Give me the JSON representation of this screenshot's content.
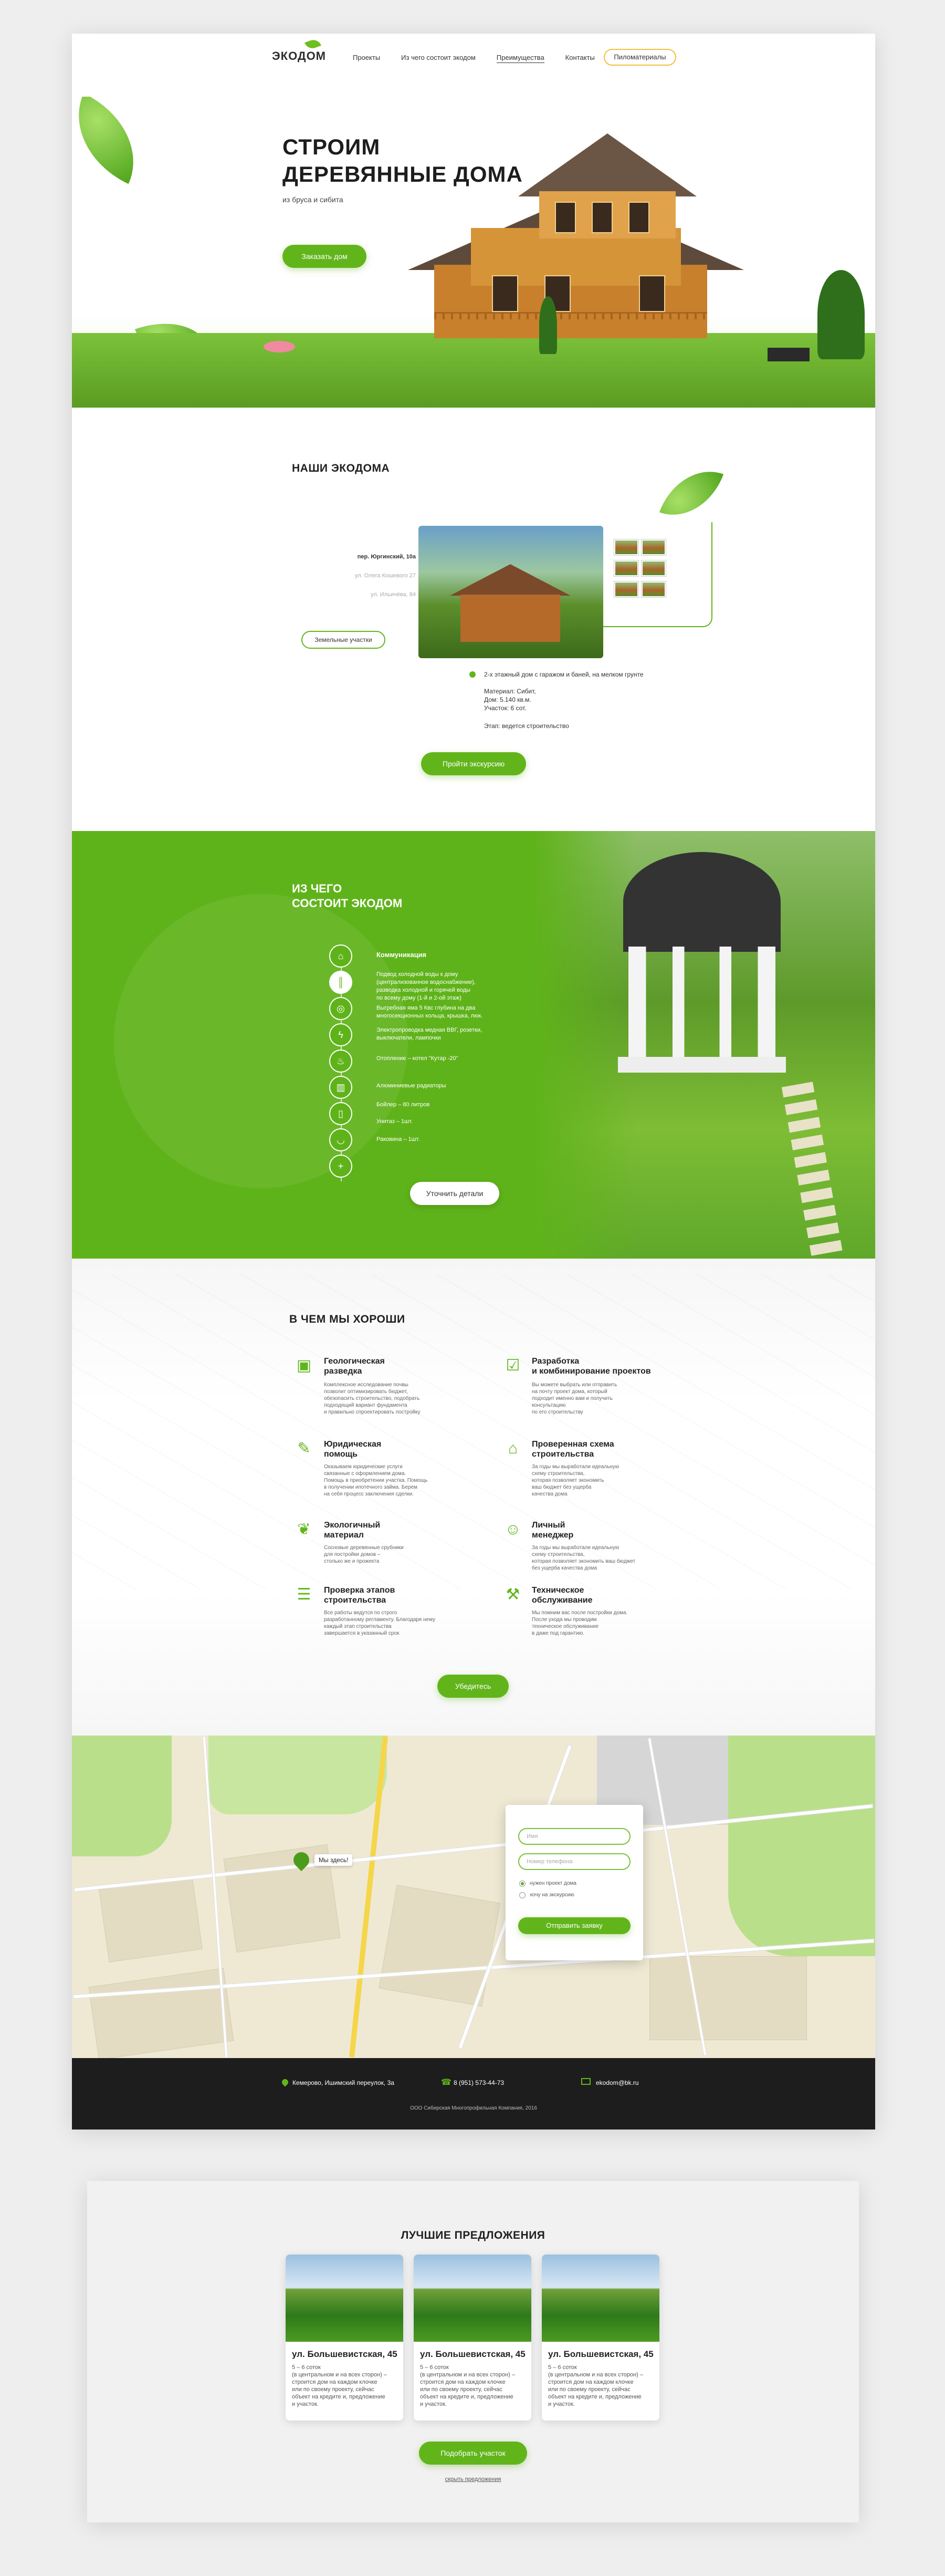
{
  "header": {
    "logo": "ЭКОДОМ",
    "nav": [
      "Проекты",
      "Из чего состоит экодом",
      "Преимущества",
      "Контакты"
    ],
    "active_nav": 2,
    "cta": "Пиломатериалы"
  },
  "hero": {
    "title": "СТРОИМ\nДЕРЕВЯННЫЕ ДОМА",
    "subtitle": "из бруса и сибита",
    "button": "Заказать дом"
  },
  "projects": {
    "title": "НАШИ ЭКОДОМА",
    "addresses": [
      "пер. Юргинский, 10а",
      "ул. Олега Кошевого 27",
      "ул. Ильичёва, 84"
    ],
    "plots_button": "Земельные участки",
    "info_lead": "2-х этажный дом с гаражом и баней, на мелком грунте",
    "info_spec": "Материал: Сибит,\nДом: 5.140 кв.м.\nУчасток: 6 сот.",
    "info_stage": "Этап: ведется строительство",
    "button": "Пройти экскурсию"
  },
  "components": {
    "title": "ИЗ ЧЕГО\nСОСТОИТ ЭКОДОМ",
    "items": [
      {
        "icon": "foundation-icon",
        "text": "Коммуникация",
        "bold": true
      },
      {
        "icon": "pipes-icon",
        "text": "Подвод холодной воды к дому\n(централизованное водоснабжение),\nразводка холодной и горячей воды\nпо всему дому (1-й и 2-ой этаж)"
      },
      {
        "icon": "well-icon",
        "text": "Выгребная яма 5 Квс глубина на два\nмногосекционных кольца, крышка, люк."
      },
      {
        "icon": "electric-icon",
        "text": "Электропроводка медная ВВГ, розетки,\nвыключатели, лампочки"
      },
      {
        "icon": "heating-icon",
        "text": "Отопление – котел \"Кутар -20\""
      },
      {
        "icon": "radiator-icon",
        "text": "Алюминиевые радиаторы"
      },
      {
        "icon": "boiler-icon",
        "text": "Бойлер – 80 литров"
      },
      {
        "icon": "sink-icon",
        "text": "Унитаз – 1шт."
      },
      {
        "icon": "shower-icon",
        "text": "Раковина – 1шт."
      },
      {
        "icon": "plus-icon",
        "text": ""
      }
    ],
    "button": "Уточнить детали"
  },
  "advantages": {
    "title": "В ЧЕМ МЫ ХОРОШИ",
    "items": [
      {
        "icon": "geology-icon",
        "title": "Геологическая\nразведка",
        "text": "Комплексное исследование почвы\nпозволит оптимизировать бюджет,\nобезопасить строительство, подобрать\nподходящий вариант фундамента\nи правильно спроектировать постройку"
      },
      {
        "icon": "blueprint-icon",
        "title": "Разработка\nи комбинирование проектов",
        "text": "Вы можете выбрать или отправить\nна почту проект дома, который\nподходит именно вам и получить\nконсультацию\nпо его строительству"
      },
      {
        "icon": "legal-icon",
        "title": "Юридическая\nпомощь",
        "text": "Оказываем юридические услуги\nсвязанные с оформлением дома.\nПомощь в приобретении участка. Помощь\nв получении ипотечного займа. Берем\nна себя процесс заключения сделки."
      },
      {
        "icon": "house-check-icon",
        "title": "Проверенная схема\nстроительства",
        "text": "За годы мы выработали идеальную\nсхему строительства,\nкоторая позволяет экономить\nваш бюджет без ущерба\nкачества дома"
      },
      {
        "icon": "leaf-icon",
        "title": "Экологичный\nматериал",
        "text": "Сосновые деревянные срубники\nдля постройки домов –\nстолько же и прожекта"
      },
      {
        "icon": "manager-icon",
        "title": "Личный\nменеджер",
        "text": "За годы мы выработали идеальную\nсхему строительства,\nкоторая позволяет экономить ваш бюджет\nбез ущерба качества дома"
      },
      {
        "icon": "checklist-icon",
        "title": "Проверка этапов\nстроительства",
        "text": "Все работы ведутся по строго\nразработанному регламенту. Благодаря нему\nкаждый этап строительства\nзавершается в указанный срок"
      },
      {
        "icon": "tools-icon",
        "title": "Техническое\nобслуживание",
        "text": "Мы помним вас после постройки дома.\nПосле ухода мы проводим\nтехническое обслуживание\nв даже под гарантию."
      }
    ],
    "button": "Убедитесь"
  },
  "map": {
    "pin_label": "Мы здесь!",
    "form": {
      "name_placeholder": "Имя",
      "phone_placeholder": "Номер телефона",
      "option_1": "нужен проект дома",
      "option_2": "хочу на экскурсию",
      "submit": "Отправить заявку"
    }
  },
  "footer": {
    "address": "Кемерово, Ишимский переулок, 3а",
    "phone": "8 (951) 573-44-73",
    "email": "ekodom@bk.ru",
    "copyright": "ООО Сибирская Многопрофильная Компания, 2016"
  },
  "offers": {
    "title": "ЛУЧШИЕ ПРЕДЛОЖЕНИЯ",
    "cards": [
      {
        "title": "ул. Большевистская, 45",
        "text": "5 – 6 соток\n(в центральном и на всех сторон) –\nстроится дом на каждом клочке\nили по своему проекту, сейчас\nобъект на кредите и, предложение\nи участок."
      },
      {
        "title": "ул. Большевистская, 45",
        "text": "5 – 6 соток\n(в центральном и на всех сторон) –\nстроится дом на каждом клочке\nили по своему проекту, сейчас\nобъект на кредите и, предложение\nи участок."
      },
      {
        "title": "ул. Большевистская, 45",
        "text": "5 – 6 соток\n(в центральном и на всех сторон) –\nстроится дом на каждом клочке\nили по своему проекту, сейчас\nобъект на кредите и, предложение\nи участок."
      }
    ],
    "button": "Подобрать участок",
    "link": "скрыть предложения"
  },
  "colors": {
    "accent": "#61b51b",
    "header_button_border": "#f0c23a",
    "footer_bg": "#1d1d1d"
  }
}
